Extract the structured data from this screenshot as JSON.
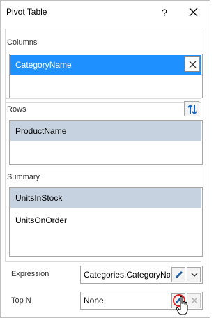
{
  "window": {
    "title": "Pivot Table",
    "help_glyph": "?"
  },
  "columns": {
    "label": "Columns",
    "items": [
      {
        "label": "CategoryName",
        "state": "selected"
      }
    ]
  },
  "rows": {
    "label": "Rows",
    "items": [
      {
        "label": "ProductName",
        "state": "highlighted"
      }
    ]
  },
  "summary": {
    "label": "Summary",
    "items": [
      {
        "label": "UnitsInStock",
        "state": "highlighted"
      },
      {
        "label": "UnitsOnOrder",
        "state": "normal"
      }
    ]
  },
  "expression": {
    "label": "Expression",
    "value": "Categories.CategoryName"
  },
  "top_n": {
    "label": "Top N",
    "value": "None"
  },
  "icons": {
    "close": "close-icon",
    "help": "help-icon",
    "swap": "swap-arrows-icon",
    "remove": "remove-x-icon",
    "edit": "pencil-icon",
    "dropdown": "chevron-down-icon",
    "clear": "clear-x-icon",
    "cursor": "mouse-pointer-icon"
  },
  "colors": {
    "selected_item": "#1e90ff",
    "highlighted_item": "#c6d2e0",
    "swap_arrows": "#1565c0",
    "pencil": "#1f5fa8",
    "focus_ring": "#d61f1f",
    "border": "#a7a7a7"
  }
}
